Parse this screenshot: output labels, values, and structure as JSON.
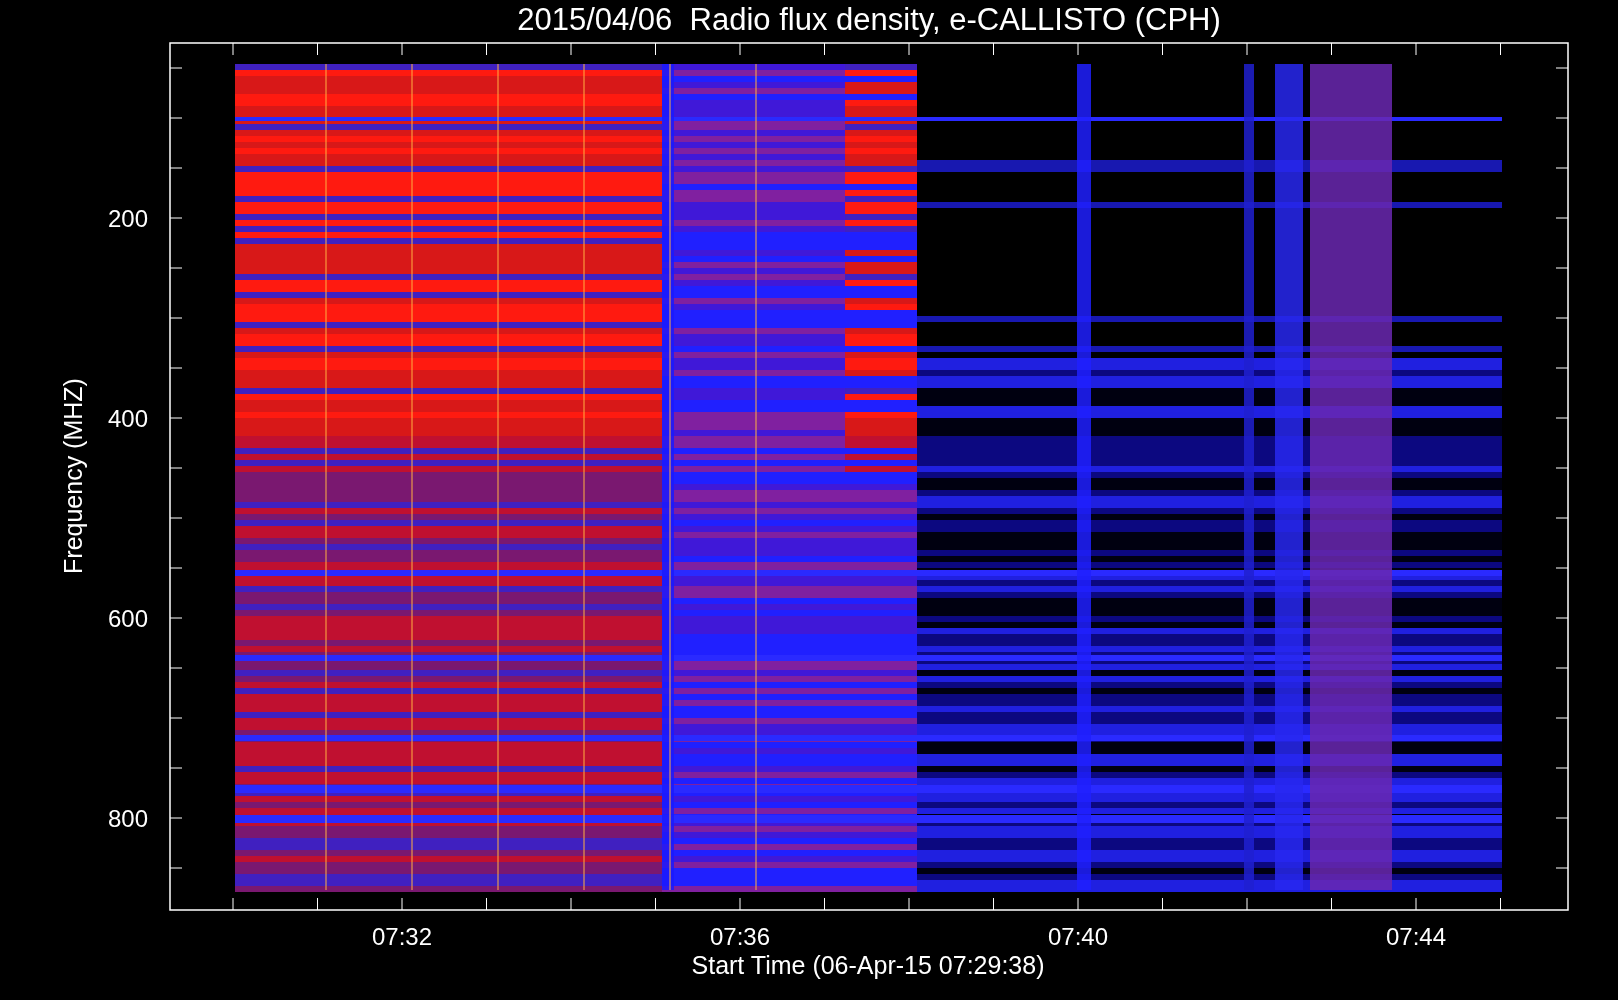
{
  "title": "2015/04/06  Radio flux density, e-CALLISTO (CPH)",
  "y_axis": {
    "label": "Frequency (MHZ)",
    "ticks": [
      "200",
      "400",
      "600",
      "800"
    ]
  },
  "x_axis": {
    "label": "Start Time (06-Apr-15 07:29:38)",
    "ticks": [
      "07:32",
      "07:36",
      "07:40",
      "07:44"
    ]
  }
}
